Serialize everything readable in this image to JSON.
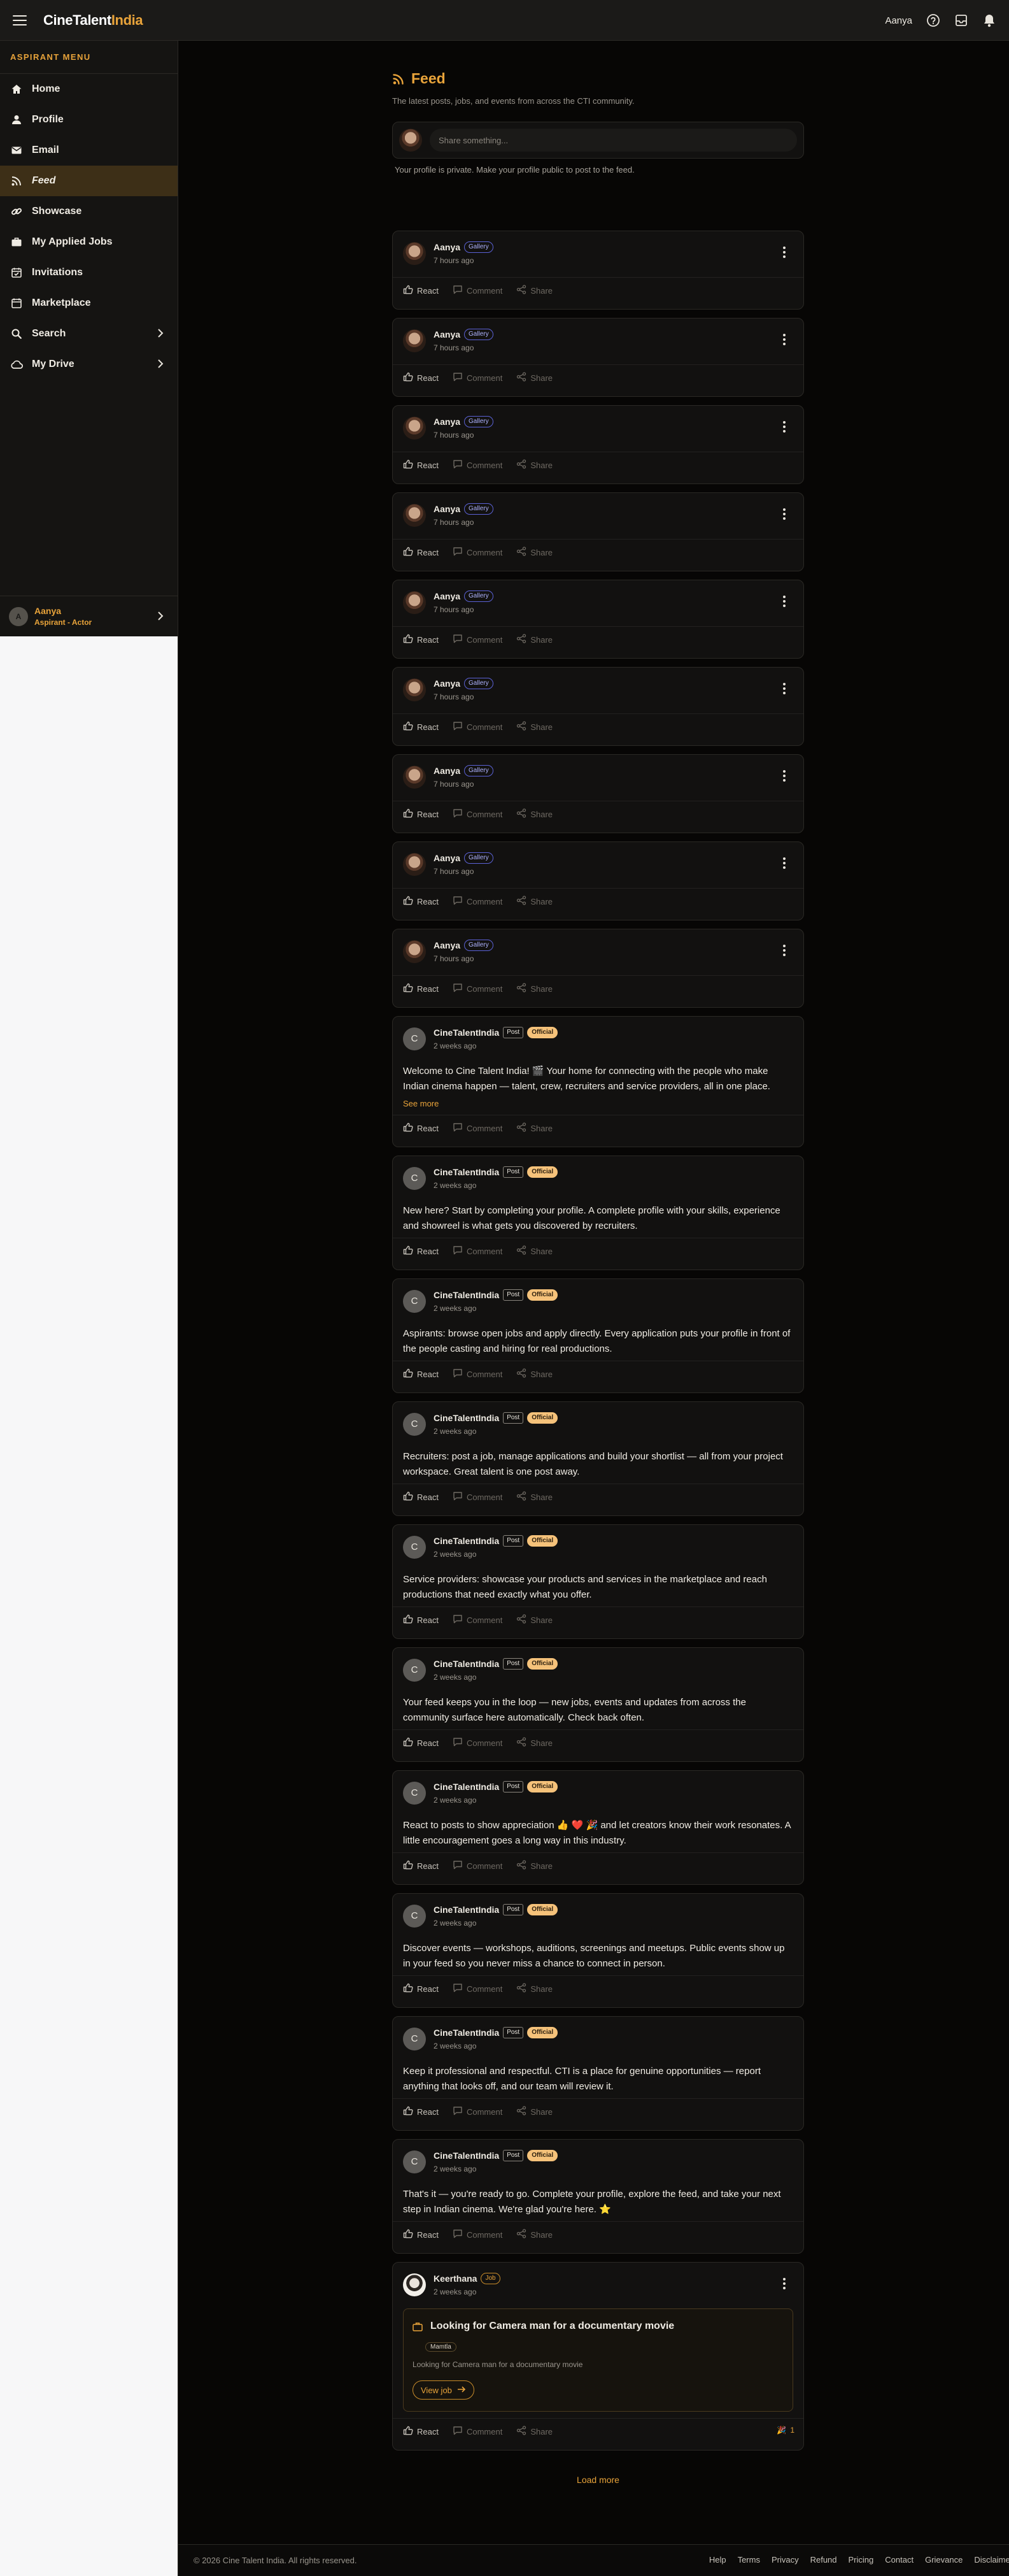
{
  "app": {
    "brand_main": "CineTalent",
    "brand_accent": "India",
    "accent_color": "#e8a33a"
  },
  "topbar": {
    "user_name": "Aanya",
    "icons": [
      "menu-icon",
      "help-icon",
      "inbox-icon",
      "bell-icon"
    ]
  },
  "sidebar": {
    "heading": "ASPIRANT MENU",
    "items": [
      {
        "label": "Home",
        "icon": "home-icon"
      },
      {
        "label": "Profile",
        "icon": "person-icon"
      },
      {
        "label": "Email",
        "icon": "mail-icon"
      },
      {
        "label": "Feed",
        "icon": "rss-icon",
        "active": true
      },
      {
        "label": "Showcase",
        "icon": "link-icon"
      },
      {
        "label": "My Applied Jobs",
        "icon": "briefcase-icon"
      },
      {
        "label": "Invitations",
        "icon": "calendar-check-icon"
      },
      {
        "label": "Marketplace",
        "icon": "store-icon"
      },
      {
        "label": "Search",
        "icon": "search-icon",
        "expandable": true
      },
      {
        "label": "My Drive",
        "icon": "cloud-icon",
        "expandable": true
      }
    ],
    "user": {
      "initial": "A",
      "name": "Aanya",
      "role": "Aspirant - Actor"
    }
  },
  "feed": {
    "title": "Feed",
    "subtitle": "The latest posts, jobs, and events from across the CTI community.",
    "composer_placeholder": "Share something...",
    "privacy_note": "Your profile is private. Make your profile public to post to the feed.",
    "actions": {
      "react": "React",
      "comment": "Comment",
      "share": "Share"
    },
    "gallery_posts": [
      {
        "author": "Aanya",
        "badge": "Gallery",
        "time": "7 hours ago"
      },
      {
        "author": "Aanya",
        "badge": "Gallery",
        "time": "7 hours ago"
      },
      {
        "author": "Aanya",
        "badge": "Gallery",
        "time": "7 hours ago"
      },
      {
        "author": "Aanya",
        "badge": "Gallery",
        "time": "7 hours ago"
      },
      {
        "author": "Aanya",
        "badge": "Gallery",
        "time": "7 hours ago"
      },
      {
        "author": "Aanya",
        "badge": "Gallery",
        "time": "7 hours ago"
      },
      {
        "author": "Aanya",
        "badge": "Gallery",
        "time": "7 hours ago"
      },
      {
        "author": "Aanya",
        "badge": "Gallery",
        "time": "7 hours ago"
      },
      {
        "author": "Aanya",
        "badge": "Gallery",
        "time": "7 hours ago"
      }
    ],
    "official_posts": [
      {
        "initial": "C",
        "author": "CineTalentIndia",
        "badge1": "Post",
        "badge2": "Official",
        "time": "2 weeks ago",
        "text": "Welcome to Cine Talent India! 🎬 Your home for connecting with the people who make Indian cinema happen — talent, crew, recruiters and service providers, all in one place.",
        "see_more": "See more"
      },
      {
        "initial": "C",
        "author": "CineTalentIndia",
        "badge1": "Post",
        "badge2": "Official",
        "time": "2 weeks ago",
        "text": "New here? Start by completing your profile. A complete profile with your skills, experience and showreel is what gets you discovered by recruiters."
      },
      {
        "initial": "C",
        "author": "CineTalentIndia",
        "badge1": "Post",
        "badge2": "Official",
        "time": "2 weeks ago",
        "text": "Aspirants: browse open jobs and apply directly. Every application puts your profile in front of the people casting and hiring for real productions."
      },
      {
        "initial": "C",
        "author": "CineTalentIndia",
        "badge1": "Post",
        "badge2": "Official",
        "time": "2 weeks ago",
        "text": "Recruiters: post a job, manage applications and build your shortlist — all from your project workspace. Great talent is one post away."
      },
      {
        "initial": "C",
        "author": "CineTalentIndia",
        "badge1": "Post",
        "badge2": "Official",
        "time": "2 weeks ago",
        "text": "Service providers: showcase your products and services in the marketplace and reach productions that need exactly what you offer."
      },
      {
        "initial": "C",
        "author": "CineTalentIndia",
        "badge1": "Post",
        "badge2": "Official",
        "time": "2 weeks ago",
        "text": "Your feed keeps you in the loop — new jobs, events and updates from across the community surface here automatically. Check back often."
      },
      {
        "initial": "C",
        "author": "CineTalentIndia",
        "badge1": "Post",
        "badge2": "Official",
        "time": "2 weeks ago",
        "text": "React to posts to show appreciation 👍 ❤️ 🎉 and let creators know their work resonates. A little encouragement goes a long way in this industry."
      },
      {
        "initial": "C",
        "author": "CineTalentIndia",
        "badge1": "Post",
        "badge2": "Official",
        "time": "2 weeks ago",
        "text": "Discover events — workshops, auditions, screenings and meetups. Public events show up in your feed so you never miss a chance to connect in person."
      },
      {
        "initial": "C",
        "author": "CineTalentIndia",
        "badge1": "Post",
        "badge2": "Official",
        "time": "2 weeks ago",
        "text": "Keep it professional and respectful. CTI is a place for genuine opportunities — report anything that looks off, and our team will review it."
      },
      {
        "initial": "C",
        "author": "CineTalentIndia",
        "badge1": "Post",
        "badge2": "Official",
        "time": "2 weeks ago",
        "text": "That's it — you're ready to go. Complete your profile, explore the feed, and take your next step in Indian cinema. We're glad you're here. ⭐"
      }
    ],
    "job_post": {
      "author": "Keerthana",
      "badge": "Job",
      "time": "2 weeks ago",
      "job_title": "Looking for Camera man for a documentary movie",
      "tag": "Mamtla",
      "description": "Looking for Camera man for a documentary movie",
      "view_label": "View job",
      "reaction_count": "1"
    },
    "load_more": "Load more"
  },
  "footer": {
    "copyright": "© 2026 Cine Talent India. All rights reserved.",
    "links": [
      "Help",
      "Terms",
      "Privacy",
      "Refund",
      "Pricing",
      "Contact",
      "Grievance",
      "Disclaimer"
    ]
  }
}
